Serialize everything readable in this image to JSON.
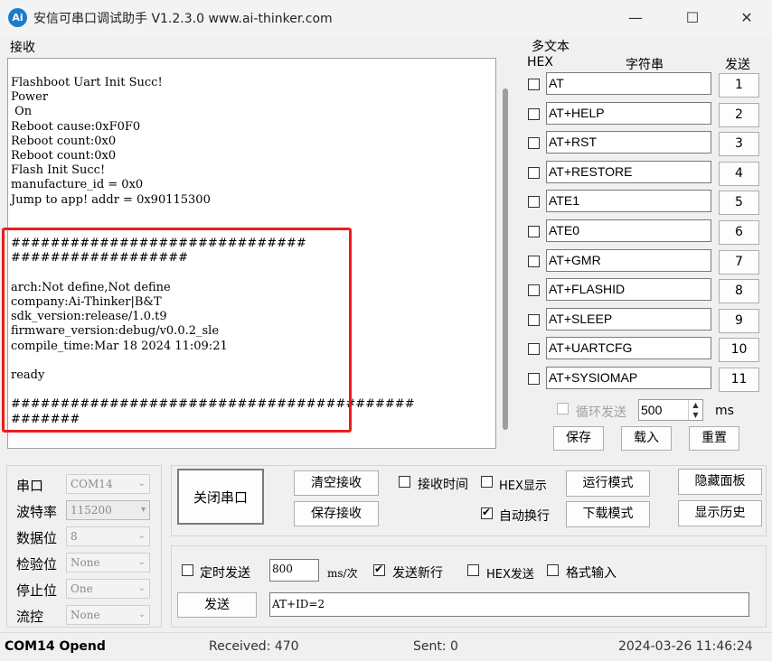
{
  "window": {
    "title": "安信可串口调试助手 V1.2.3.0    www.ai-thinker.com",
    "logo_text": "Ai",
    "minimize": "—",
    "maximize": "☐",
    "close": "✕"
  },
  "receive": {
    "group_label": "接收",
    "text": "Flashboot Uart Init Succ!\nPower\n On\nReboot cause:0xF0F0\nReboot count:0x0\nReboot count:0x0\nFlash Init Succ!\nmanufacture_id = 0x0\nJump to app! addr = 0x90115300\n\n\n##############################\n##################\n\narch:Not define,Not define\ncompany:Ai-Thinker|B&T\nsdk_version:release/1.0.t9\nfirmware_version:debug/v0.0.2_sle\ncompile_time:Mar 18 2024 11:09:21\n\nready\n\n#########################################\n#######"
  },
  "multi_text": {
    "group_label": "多文本",
    "col_hex": "HEX",
    "col_string": "字符串",
    "col_send": "发送",
    "rows": [
      {
        "text": "AT",
        "num": "1"
      },
      {
        "text": "AT+HELP",
        "num": "2"
      },
      {
        "text": "AT+RST",
        "num": "3"
      },
      {
        "text": "AT+RESTORE",
        "num": "4"
      },
      {
        "text": "ATE1",
        "num": "5"
      },
      {
        "text": "ATE0",
        "num": "6"
      },
      {
        "text": "AT+GMR",
        "num": "7"
      },
      {
        "text": "AT+FLASHID",
        "num": "8"
      },
      {
        "text": "AT+SLEEP",
        "num": "9"
      },
      {
        "text": "AT+UARTCFG",
        "num": "10"
      },
      {
        "text": "AT+SYSIOMAP",
        "num": "11"
      }
    ],
    "loop_label": "循环发送",
    "loop_value": "500",
    "loop_unit": "ms",
    "save_btn": "保存",
    "load_btn": "载入",
    "reset_btn": "重置"
  },
  "port_settings": {
    "port_label": "串口",
    "port_value": "COM14",
    "baud_label": "波特率",
    "baud_value": "115200",
    "data_label": "数据位",
    "data_value": "8",
    "parity_label": "检验位",
    "parity_value": "None",
    "stop_label": "停止位",
    "stop_value": "One",
    "flow_label": "流控",
    "flow_value": "None"
  },
  "controls": {
    "close_port_btn": "关闭串口",
    "clear_recv_btn": "清空接收",
    "save_recv_btn": "保存接收",
    "recv_time_label": "接收时间",
    "hex_display_label": "HEX显示",
    "auto_wrap_label": "自动换行",
    "run_mode_btn": "运行模式",
    "download_mode_btn": "下载模式",
    "hide_panel_btn": "隐藏面板",
    "show_history_btn": "显示历史"
  },
  "send": {
    "timed_label": "定时发送",
    "interval_value": "800",
    "interval_unit": "ms/次",
    "newline_label": "发送新行",
    "hex_send_label": "HEX发送",
    "format_input_label": "格式输入",
    "send_btn": "发送",
    "input_value": "AT+ID=2"
  },
  "status": {
    "port_state": "COM14 Opend",
    "received": "Received: 470",
    "sent": "Sent: 0",
    "datetime": "2024-03-26 11:46:24"
  },
  "colors": {
    "highlight_border": "#ee1c1c",
    "logo_bg": "#1b7cc9"
  }
}
